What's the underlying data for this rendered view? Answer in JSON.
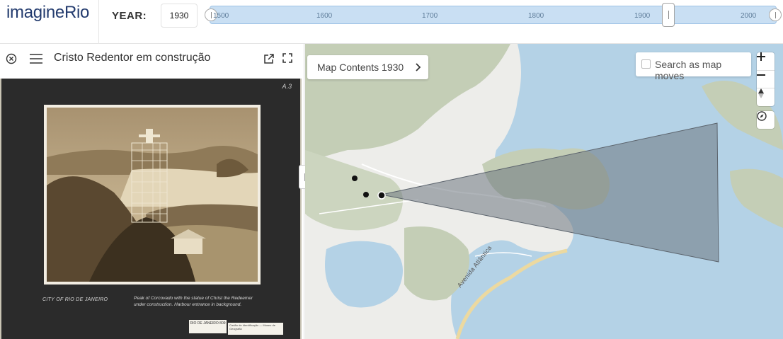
{
  "app": {
    "logo": "imagineRio"
  },
  "header": {
    "year_label": "YEAR:",
    "year_value": "1930"
  },
  "timeline": {
    "ticks": [
      "1500",
      "1600",
      "1700",
      "1800",
      "1900",
      "2000"
    ]
  },
  "panel": {
    "title": "Cristo Redentor em construção",
    "page_number": "A.3",
    "caption_city": "CITY OF RIO DE JANEIRO",
    "caption_desc": "Peak of Corcovado with the statue of Christ the Redeemer under construction. Harbour entrance in background.",
    "label_main": "RIO DE JANEIRO 809",
    "label_side": "Cartão de Identificação — Museu de Geografia"
  },
  "map": {
    "contents_label": "Map Contents 1930",
    "search_label": "Search as map moves",
    "search_checked": false,
    "street_label": "Avenida Atlântica",
    "colors": {
      "water": "#b4d2e6",
      "land": "#ededea",
      "hills": "#c4ceb6",
      "viewcone": "#6e7680",
      "accent": "#233b6e"
    }
  },
  "icons": {
    "close": "close-circle-icon",
    "menu": "hamburger-menu-icon",
    "open": "external-link-icon",
    "fullscreen": "fullscreen-icon",
    "chevron": "chevron-right-icon",
    "zoom_in": "plus-icon",
    "zoom_out": "minus-icon",
    "north": "compass-north-icon",
    "locate": "navigation-icon"
  }
}
